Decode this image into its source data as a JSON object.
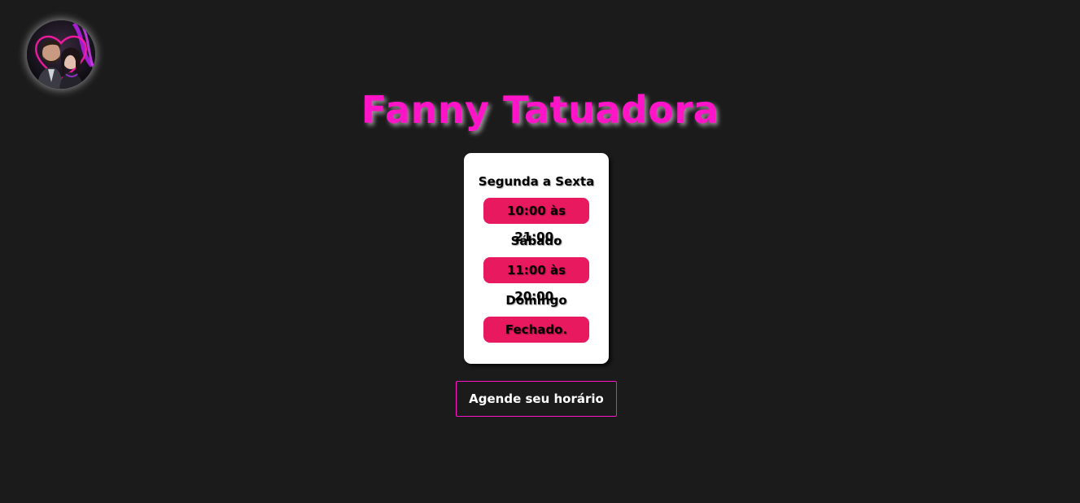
{
  "header": {
    "title": "Fanny Tatuadora",
    "avatar_icon": "profile-photo",
    "title_color": "#ff14c8"
  },
  "schedule": {
    "days": [
      {
        "label": "Segunda a Sexta",
        "hours": "10:00 às 21:00."
      },
      {
        "label": "Sábado",
        "hours": "11:00 às 20:00."
      },
      {
        "label": "Domingo",
        "hours": "Fechado."
      }
    ],
    "pill_color": "#e8195e"
  },
  "cta": {
    "label": "Agende seu horário",
    "border_color": "#ff14c8"
  }
}
